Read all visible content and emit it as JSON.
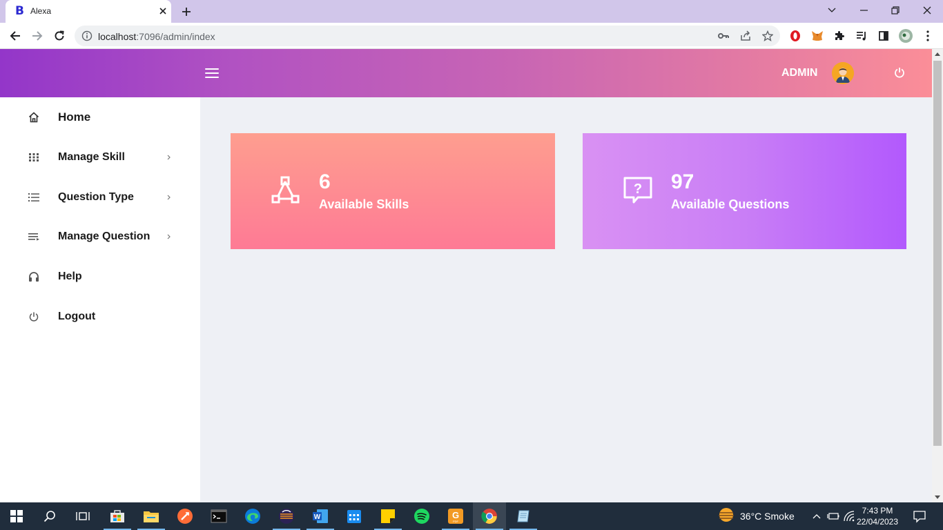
{
  "browser": {
    "tab_title": "Alexa",
    "tab_favicon_letter": "B",
    "url_host": "localhost",
    "url_rest": ":7096/admin/index"
  },
  "header": {
    "admin_label": "ADMIN"
  },
  "sidebar": {
    "items": [
      {
        "label": "Home",
        "icon": "home-icon",
        "has_submenu": false
      },
      {
        "label": "Manage Skill",
        "icon": "grid-icon",
        "has_submenu": true
      },
      {
        "label": "Question Type",
        "icon": "list-icon",
        "has_submenu": true
      },
      {
        "label": "Manage Question",
        "icon": "lines-icon",
        "has_submenu": true
      },
      {
        "label": "Help",
        "icon": "headset-icon",
        "has_submenu": false
      },
      {
        "label": "Logout",
        "icon": "power-icon",
        "has_submenu": false
      }
    ]
  },
  "cards": {
    "skills": {
      "value": "6",
      "label": "Available Skills",
      "icon": "network-icon"
    },
    "questions": {
      "value": "97",
      "label": "Available Questions",
      "icon": "question-bubble-icon"
    }
  },
  "taskbar": {
    "weather": "36°C  Smoke",
    "time": "7:43 PM",
    "date": "22/04/2023"
  },
  "colors": {
    "header_gradient_start": "#9336c9",
    "header_gradient_end": "#fb8e98",
    "skills_card": "#fe8a92",
    "questions_card": "#c97ef6",
    "taskbar": "#202d3c"
  }
}
